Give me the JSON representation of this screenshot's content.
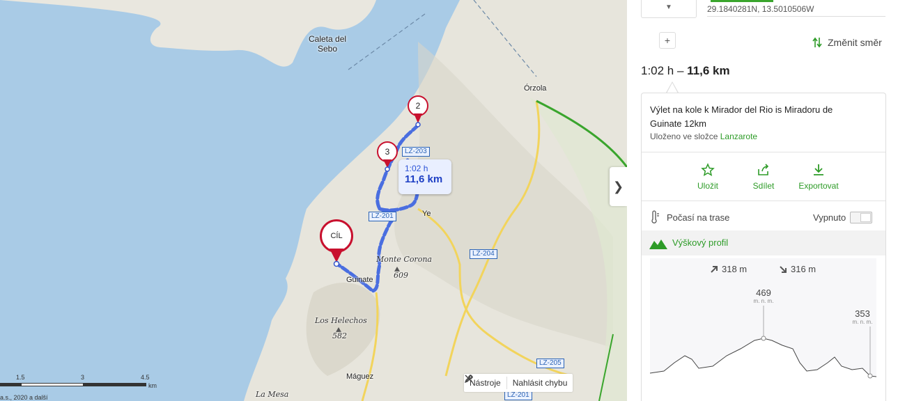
{
  "map": {
    "places": {
      "caleta": "Caleta del\nSebo",
      "orzola": "Órzola",
      "ye": "Ye",
      "guinate": "Guinate",
      "monte_corona": "Monte Corona",
      "monte_corona_elev": "609",
      "los_helechos": "Los Helechos",
      "los_helechos_elev": "582",
      "maguez": "Máguez",
      "la_mesa": "La Mesa"
    },
    "roads": {
      "lz203": "LZ-203",
      "lz201": "LZ-201",
      "lz204": "LZ-204",
      "lz205": "LZ-205",
      "lz201b": "LZ-201"
    },
    "pins": {
      "p2": "2",
      "p3": "3",
      "finish": "CÍL"
    },
    "route_box": {
      "time": "1:02 h",
      "distance": "11,6 km"
    },
    "scale": {
      "t1": "1.5",
      "t2": "3",
      "t3": "4.5",
      "unit": "km"
    },
    "copyright": "a.s., 2020 a další",
    "tools": {
      "tools_label": "Nástroje",
      "report_label": "Nahlásit chybu"
    },
    "colors": {
      "route": "#4a6ee0",
      "water": "#a9cbe6",
      "land": "#e9e7df",
      "pin": "#c8102e"
    }
  },
  "panel": {
    "coords": "29.1840281N, 13.5010506W",
    "change_direction": "Změnit směr",
    "summary_time": "1:02 h",
    "summary_sep": " – ",
    "summary_distance": "11,6 km",
    "trip_name": "Výlet na kole k Mirador del Rio is Miradoru de Guinate 12km",
    "saved_prefix": "Uloženo ve složce",
    "saved_folder": "Lanzarote",
    "actions": {
      "save": "Uložit",
      "share": "Sdílet",
      "export": "Exportovat"
    },
    "weather_label": "Počasí na trase",
    "weather_state": "Vypnuto",
    "profile_title": "Výškový profil",
    "ascent": "318 m",
    "descent": "316 m",
    "peak1": {
      "value": "469",
      "unit": "m. n. m."
    },
    "peak2": {
      "value": "353",
      "unit": "m. n. m."
    },
    "accent_color": "#2d9b27"
  }
}
